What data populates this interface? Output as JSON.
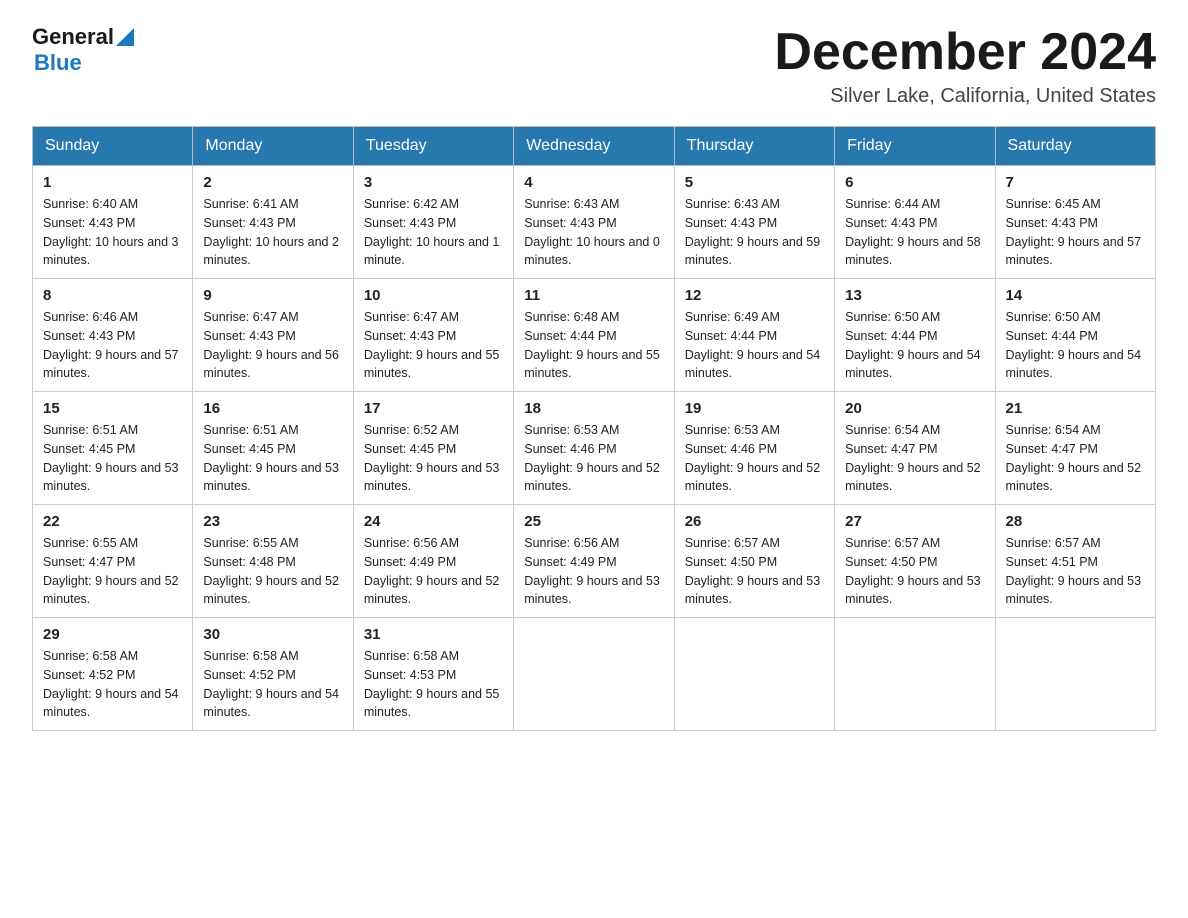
{
  "header": {
    "logo_general": "General",
    "logo_blue": "Blue",
    "month_title": "December 2024",
    "location": "Silver Lake, California, United States"
  },
  "days_of_week": [
    "Sunday",
    "Monday",
    "Tuesday",
    "Wednesday",
    "Thursday",
    "Friday",
    "Saturday"
  ],
  "weeks": [
    [
      {
        "day": 1,
        "sunrise": "6:40 AM",
        "sunset": "4:43 PM",
        "daylight": "10 hours and 3 minutes."
      },
      {
        "day": 2,
        "sunrise": "6:41 AM",
        "sunset": "4:43 PM",
        "daylight": "10 hours and 2 minutes."
      },
      {
        "day": 3,
        "sunrise": "6:42 AM",
        "sunset": "4:43 PM",
        "daylight": "10 hours and 1 minute."
      },
      {
        "day": 4,
        "sunrise": "6:43 AM",
        "sunset": "4:43 PM",
        "daylight": "10 hours and 0 minutes."
      },
      {
        "day": 5,
        "sunrise": "6:43 AM",
        "sunset": "4:43 PM",
        "daylight": "9 hours and 59 minutes."
      },
      {
        "day": 6,
        "sunrise": "6:44 AM",
        "sunset": "4:43 PM",
        "daylight": "9 hours and 58 minutes."
      },
      {
        "day": 7,
        "sunrise": "6:45 AM",
        "sunset": "4:43 PM",
        "daylight": "9 hours and 57 minutes."
      }
    ],
    [
      {
        "day": 8,
        "sunrise": "6:46 AM",
        "sunset": "4:43 PM",
        "daylight": "9 hours and 57 minutes."
      },
      {
        "day": 9,
        "sunrise": "6:47 AM",
        "sunset": "4:43 PM",
        "daylight": "9 hours and 56 minutes."
      },
      {
        "day": 10,
        "sunrise": "6:47 AM",
        "sunset": "4:43 PM",
        "daylight": "9 hours and 55 minutes."
      },
      {
        "day": 11,
        "sunrise": "6:48 AM",
        "sunset": "4:44 PM",
        "daylight": "9 hours and 55 minutes."
      },
      {
        "day": 12,
        "sunrise": "6:49 AM",
        "sunset": "4:44 PM",
        "daylight": "9 hours and 54 minutes."
      },
      {
        "day": 13,
        "sunrise": "6:50 AM",
        "sunset": "4:44 PM",
        "daylight": "9 hours and 54 minutes."
      },
      {
        "day": 14,
        "sunrise": "6:50 AM",
        "sunset": "4:44 PM",
        "daylight": "9 hours and 54 minutes."
      }
    ],
    [
      {
        "day": 15,
        "sunrise": "6:51 AM",
        "sunset": "4:45 PM",
        "daylight": "9 hours and 53 minutes."
      },
      {
        "day": 16,
        "sunrise": "6:51 AM",
        "sunset": "4:45 PM",
        "daylight": "9 hours and 53 minutes."
      },
      {
        "day": 17,
        "sunrise": "6:52 AM",
        "sunset": "4:45 PM",
        "daylight": "9 hours and 53 minutes."
      },
      {
        "day": 18,
        "sunrise": "6:53 AM",
        "sunset": "4:46 PM",
        "daylight": "9 hours and 52 minutes."
      },
      {
        "day": 19,
        "sunrise": "6:53 AM",
        "sunset": "4:46 PM",
        "daylight": "9 hours and 52 minutes."
      },
      {
        "day": 20,
        "sunrise": "6:54 AM",
        "sunset": "4:47 PM",
        "daylight": "9 hours and 52 minutes."
      },
      {
        "day": 21,
        "sunrise": "6:54 AM",
        "sunset": "4:47 PM",
        "daylight": "9 hours and 52 minutes."
      }
    ],
    [
      {
        "day": 22,
        "sunrise": "6:55 AM",
        "sunset": "4:47 PM",
        "daylight": "9 hours and 52 minutes."
      },
      {
        "day": 23,
        "sunrise": "6:55 AM",
        "sunset": "4:48 PM",
        "daylight": "9 hours and 52 minutes."
      },
      {
        "day": 24,
        "sunrise": "6:56 AM",
        "sunset": "4:49 PM",
        "daylight": "9 hours and 52 minutes."
      },
      {
        "day": 25,
        "sunrise": "6:56 AM",
        "sunset": "4:49 PM",
        "daylight": "9 hours and 53 minutes."
      },
      {
        "day": 26,
        "sunrise": "6:57 AM",
        "sunset": "4:50 PM",
        "daylight": "9 hours and 53 minutes."
      },
      {
        "day": 27,
        "sunrise": "6:57 AM",
        "sunset": "4:50 PM",
        "daylight": "9 hours and 53 minutes."
      },
      {
        "day": 28,
        "sunrise": "6:57 AM",
        "sunset": "4:51 PM",
        "daylight": "9 hours and 53 minutes."
      }
    ],
    [
      {
        "day": 29,
        "sunrise": "6:58 AM",
        "sunset": "4:52 PM",
        "daylight": "9 hours and 54 minutes."
      },
      {
        "day": 30,
        "sunrise": "6:58 AM",
        "sunset": "4:52 PM",
        "daylight": "9 hours and 54 minutes."
      },
      {
        "day": 31,
        "sunrise": "6:58 AM",
        "sunset": "4:53 PM",
        "daylight": "9 hours and 55 minutes."
      },
      null,
      null,
      null,
      null
    ]
  ]
}
